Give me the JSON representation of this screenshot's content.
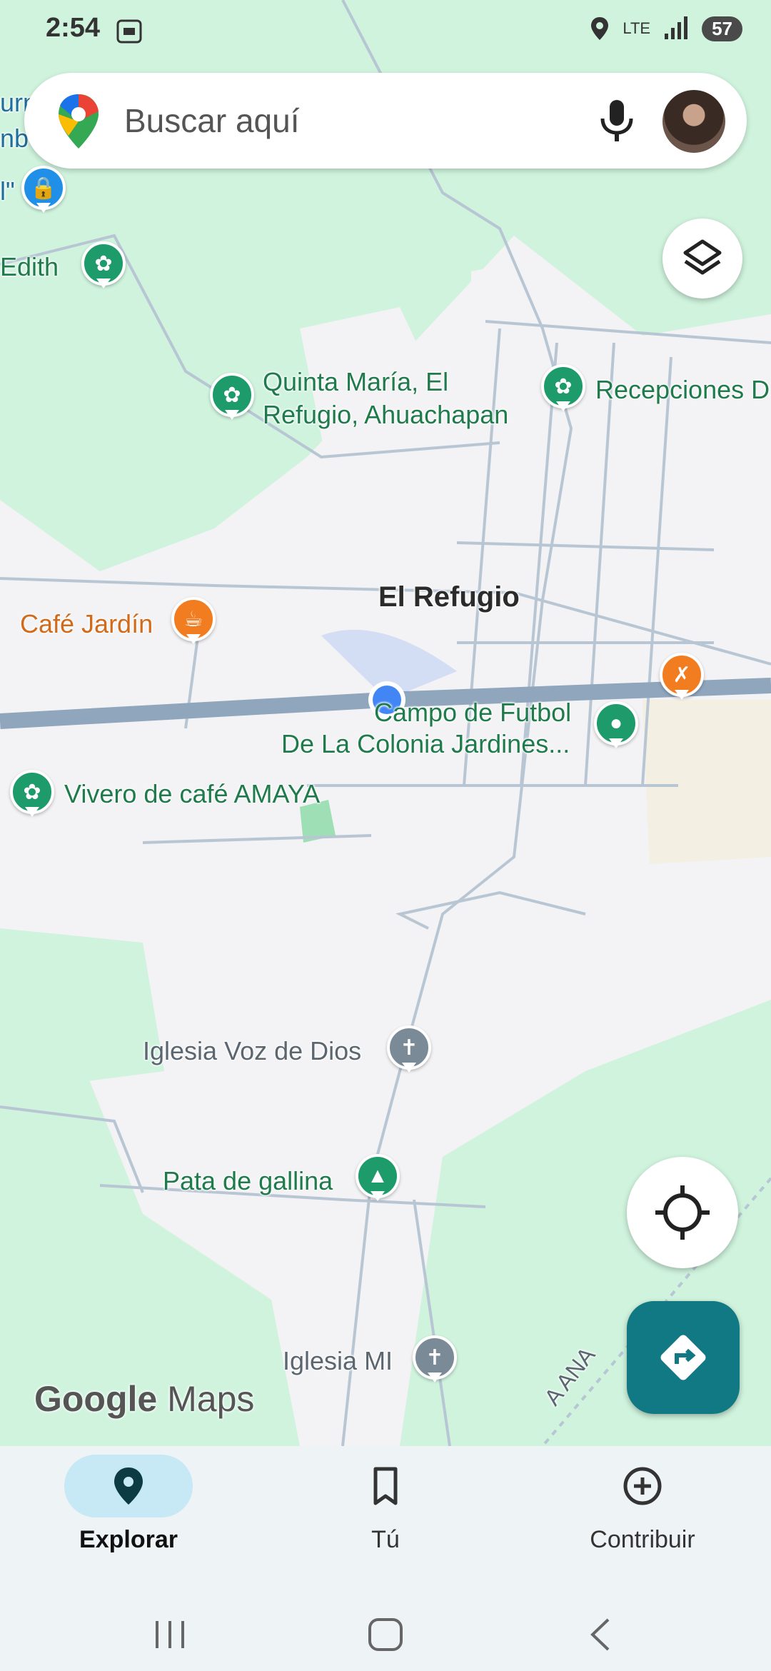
{
  "status_bar": {
    "time": "2:54",
    "network": "LTE",
    "battery": "57"
  },
  "search": {
    "placeholder": "Buscar aquí"
  },
  "map": {
    "town_label": "El Refugio",
    "places": [
      {
        "name": "Quinta María, El\nRefugio, Ahuachapan",
        "icon": "flower-icon"
      },
      {
        "name": "Recepciones D",
        "icon": "flower-icon"
      },
      {
        "name": "Edith",
        "icon": "flower-icon"
      },
      {
        "name": "Café Jardín",
        "icon": "coffee-icon"
      },
      {
        "name": "Campo de Futbol",
        "icon": "park-icon"
      },
      {
        "name": "De La Colonia Jardines...",
        "icon": "park-icon"
      },
      {
        "name": "Vivero de café AMAYA",
        "icon": "flower-icon"
      },
      {
        "name": "Iglesia Voz de Dios",
        "icon": "church-icon"
      },
      {
        "name": "Pata de gallina",
        "icon": "tree-icon"
      },
      {
        "name": "Iglesia MI",
        "icon": "church-icon"
      }
    ],
    "road_label": "A ANA",
    "partial_labels": [
      "urn",
      "nb",
      "l\""
    ]
  },
  "watermark": {
    "google": "Google",
    "maps": "Maps"
  },
  "bottom_nav": {
    "items": [
      {
        "label": "Explorar",
        "icon": "explore-pin-icon",
        "active": true
      },
      {
        "label": "Tú",
        "icon": "bookmark-icon",
        "active": false
      },
      {
        "label": "Contribuir",
        "icon": "add-circle-icon",
        "active": false
      }
    ]
  },
  "colors": {
    "accent": "#117983",
    "map_green": "#cff3dd",
    "location_blue": "#4285f4"
  }
}
